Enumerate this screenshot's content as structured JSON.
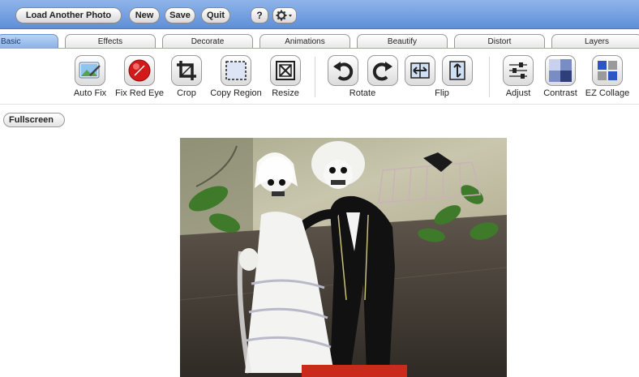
{
  "toolbar": {
    "load_label": "Load Another Photo",
    "new_label": "New",
    "save_label": "Save",
    "quit_label": "Quit",
    "help_label": "?",
    "settings_icon": "gear-icon"
  },
  "tabs": [
    {
      "label": "Basic",
      "active": true
    },
    {
      "label": "Effects"
    },
    {
      "label": "Decorate"
    },
    {
      "label": "Animations"
    },
    {
      "label": "Beautify"
    },
    {
      "label": "Distort"
    },
    {
      "label": "Layers"
    }
  ],
  "tools": {
    "auto_fix": "Auto Fix",
    "fix_red_eye": "Fix Red Eye",
    "crop": "Crop",
    "copy_region": "Copy Region",
    "resize": "Resize",
    "rotate": "Rotate",
    "flip": "Flip",
    "adjust": "Adjust",
    "contrast": "Contrast",
    "ez_collage": "EZ Collage"
  },
  "fullscreen_label": "Fullscreen",
  "colors": {
    "toolbar_blue": "#6f9de0",
    "active_tab": "#9fc1ee",
    "red_eye": "#d21a1a"
  }
}
